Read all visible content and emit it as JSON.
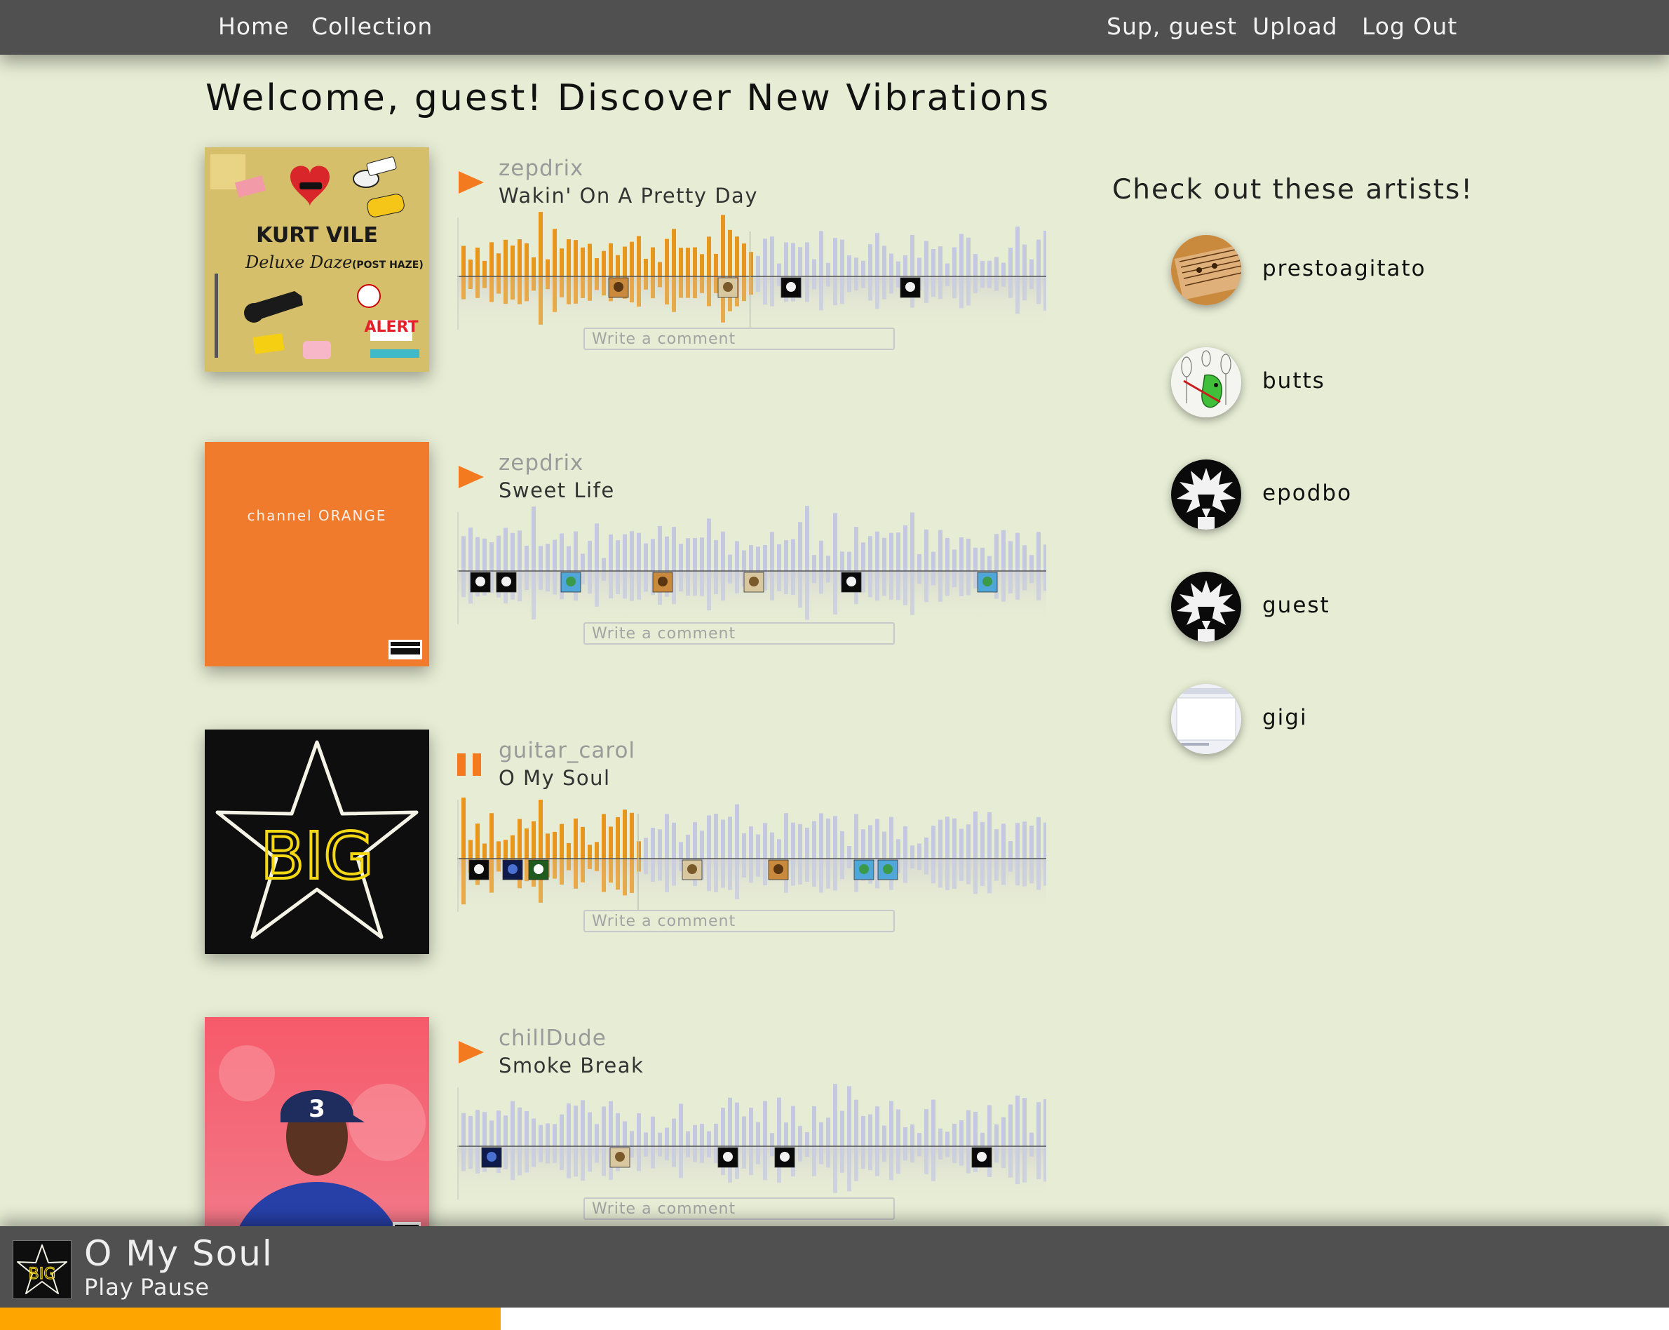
{
  "nav": {
    "home": "Home",
    "collection": "Collection",
    "greeting": "Sup, guest",
    "upload": "Upload",
    "logout": "Log Out"
  },
  "welcome": "Welcome, guest! Discover New Vibrations",
  "tracks": [
    {
      "artist": "zepdrix",
      "title": "Wakin' On A Pretty Day",
      "state": "paused",
      "progress": 0.49,
      "comment_placeholder": "Write a comment",
      "cover_text": [
        "KURT VILE",
        "Deluxe Daze",
        "(POST HAZE)",
        "ALERT"
      ],
      "comment_avatars": [
        "sheet-music",
        "cat",
        "spiky-hair",
        "spiky-hair"
      ]
    },
    {
      "artist": "zepdrix",
      "title": "Sweet Life",
      "state": "paused",
      "progress": 0.0,
      "comment_placeholder": "Write a comment",
      "cover_text": [
        "channel ORANGE"
      ],
      "comment_avatars": [
        "spiky-hair",
        "spiky-hair",
        "beach",
        "sheet-music",
        "cat",
        "spiky-hair",
        "beach"
      ]
    },
    {
      "artist": "guitar_carol",
      "title": "O My Soul",
      "state": "playing",
      "progress": 0.3,
      "comment_placeholder": "Write a comment",
      "cover_text": [
        "BIG"
      ],
      "comment_avatars": [
        "spiky-hair",
        "dark-blue",
        "panda",
        "cat",
        "sheet-music",
        "beach",
        "beach"
      ]
    },
    {
      "artist": "chillDude",
      "title": "Smoke Break",
      "state": "paused",
      "progress": 0.0,
      "comment_placeholder": "Write a comment",
      "cover_text": [
        "3"
      ],
      "comment_avatars": [
        "dark-blue",
        "cat",
        "spiky-hair",
        "spiky-hair",
        "spiky-hair"
      ]
    }
  ],
  "sidebar": {
    "heading": "Check out these artists!",
    "artists": [
      {
        "name": "prestoagitato",
        "avatar": "sheet-music"
      },
      {
        "name": "butts",
        "avatar": "guitar-sketch"
      },
      {
        "name": "epodbo",
        "avatar": "spiky-hair"
      },
      {
        "name": "guest",
        "avatar": "spiky-hair"
      },
      {
        "name": "gigi",
        "avatar": "screenshot"
      }
    ]
  },
  "player": {
    "title": "O My Soul",
    "play": "Play",
    "pause": "Pause",
    "progress": 0.3
  },
  "colors": {
    "background": "#e7ecd4",
    "bar": "#505050",
    "accent": "#ffa500",
    "played": "#e8951e",
    "unplayed": "#c5c9e0",
    "control": "#f47a20"
  }
}
